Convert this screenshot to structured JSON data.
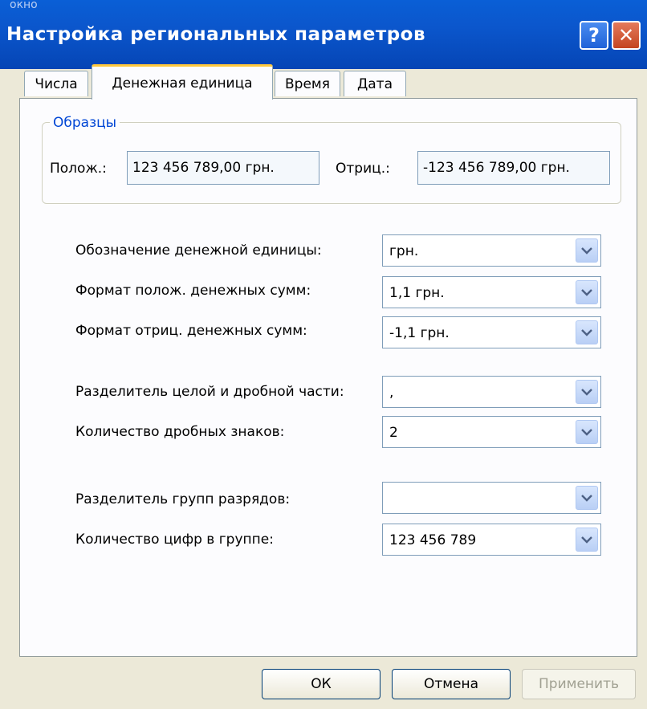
{
  "window": {
    "top_fragment": "окно",
    "title": "Настройка региональных параметров",
    "help_label": "?",
    "close_label": "✕"
  },
  "tabs": [
    {
      "label": "Числа",
      "active": false
    },
    {
      "label": "Денежная единица",
      "active": true
    },
    {
      "label": "Время",
      "active": false
    },
    {
      "label": "Дата",
      "active": false
    }
  ],
  "samples": {
    "legend": "Образцы",
    "positive_label": "Полож.:",
    "positive_value": "123 456 789,00 грн.",
    "negative_label": "Отриц.:",
    "negative_value": "-123 456 789,00 грн."
  },
  "settings": [
    {
      "label": "Обозначение денежной единицы:",
      "value": "грн."
    },
    {
      "label": "Формат полож. денежных сумм:",
      "value": "1,1 грн."
    },
    {
      "label": "Формат отриц. денежных сумм:",
      "value": "-1,1 грн."
    },
    {
      "label": "Разделитель целой и дробной части:",
      "value": ","
    },
    {
      "label": "Количество дробных знаков:",
      "value": "2"
    },
    {
      "label": "Разделитель групп разрядов:",
      "value": ""
    },
    {
      "label": "Количество цифр в группе:",
      "value": "123 456 789"
    }
  ],
  "buttons": {
    "ok": "ОК",
    "cancel": "Отмена",
    "apply": "Применить"
  },
  "colors": {
    "titlebar": "#0a5fd6",
    "active_tab_accent": "#ffc83c",
    "group_legend": "#0046d5"
  }
}
